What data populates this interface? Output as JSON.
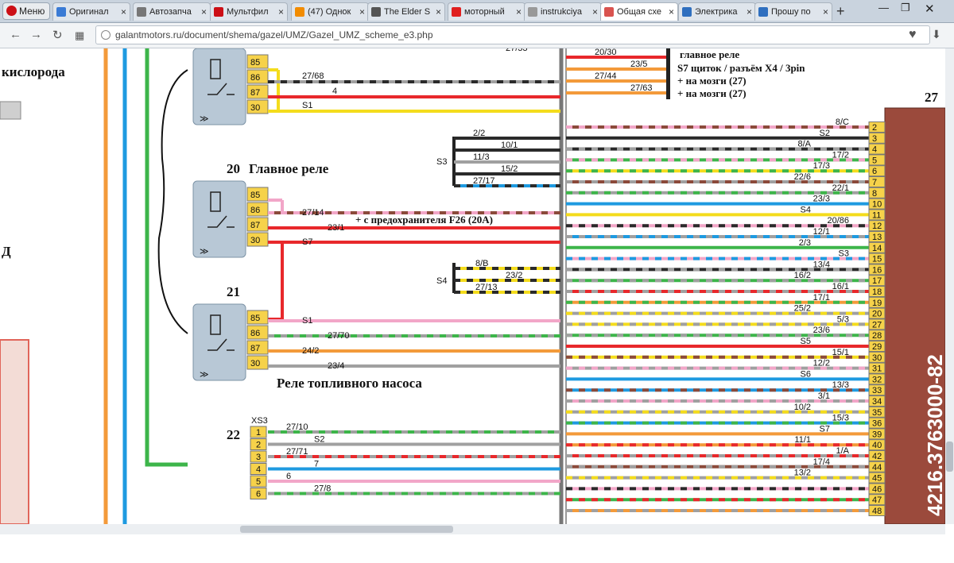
{
  "browser": {
    "menu_label": "Меню",
    "tabs": [
      {
        "title": "Оригинал",
        "icon_color": "#3a7bd5"
      },
      {
        "title": "Автозапча",
        "icon_color": "#777777"
      },
      {
        "title": "Мультфил",
        "icon_color": "#cc0f16"
      },
      {
        "title": "(47) Однок",
        "icon_color": "#f28c00"
      },
      {
        "title": "The Elder S",
        "icon_color": "#555555"
      },
      {
        "title": "моторный",
        "icon_color": "#e02020"
      },
      {
        "title": "instrukciya",
        "icon_color": "#999999"
      },
      {
        "title": "Общая схе",
        "icon_color": "#d9534f"
      },
      {
        "title": "Электрика",
        "icon_color": "#2f6fbf"
      },
      {
        "title": "Прошу по",
        "icon_color": "#2f6fbf"
      }
    ],
    "active_tab": 7,
    "close_glyph": "×",
    "newtab_glyph": "+",
    "url": "galantmotors.ru/document/shema/gazel/UMZ/Gazel_UMZ_scheme_e3.php"
  },
  "diagram": {
    "left_texts": {
      "o2": "кислорода",
      "dd": "Д"
    },
    "relay20": {
      "number": "20",
      "title": "Главное реле",
      "pins": [
        "85",
        "86",
        "87",
        "30"
      ],
      "wires": [
        "27/14",
        "23/1",
        "S7"
      ]
    },
    "relay_top": {
      "pins": [
        "85",
        "86",
        "87",
        "30"
      ],
      "wires": [
        "27/68",
        "4",
        "S1"
      ]
    },
    "relay21": {
      "number": "21",
      "title": "Реле топливного насоса",
      "pins": [
        "85",
        "86",
        "87",
        "30"
      ],
      "wires": [
        "S1",
        "27/70",
        "24/2",
        "23/4"
      ]
    },
    "connector22": {
      "number": "22",
      "name": "XS3",
      "pins": [
        "1",
        "2",
        "3",
        "4",
        "5",
        "6"
      ],
      "wires": [
        "27/10",
        "S2",
        "27/71",
        "7",
        "6",
        "27/8"
      ]
    },
    "s3": {
      "label": "S3",
      "wires": [
        "2/2",
        "10/1",
        "11/3",
        "15/2",
        "27/17"
      ]
    },
    "s4": {
      "label": "S4",
      "wires": [
        "8/B",
        "23/2",
        "27/13"
      ]
    },
    "top_wires": [
      "20/30",
      "23/5",
      "27/44",
      "27/63",
      "27/33"
    ],
    "notes": {
      "main_relay": "главное реле",
      "s7_panel": "S7  щиток / разъём X4 / 3pin",
      "ecu1": "+ на мозги (27)",
      "ecu2": "+ на мозги (27)",
      "fuse": "+ с предохранителя F26 (20A)"
    },
    "ecu": {
      "number": "27",
      "part": "4216.3763000-82",
      "pins": [
        "2",
        "3",
        "4",
        "5",
        "6",
        "7",
        "8",
        "10",
        "11",
        "12",
        "13",
        "14",
        "15",
        "16",
        "17",
        "18",
        "19",
        "20",
        "27",
        "28",
        "29",
        "30",
        "31",
        "32",
        "33",
        "34",
        "35",
        "36",
        "39",
        "40",
        "42",
        "44",
        "45",
        "46",
        "47",
        "48"
      ],
      "wires": [
        "8/C",
        "S2",
        "8/A",
        "17/2",
        "17/3",
        "22/6",
        "22/1",
        "23/3",
        "S4",
        "20/86",
        "12/1",
        "2/3",
        "S3",
        "13/4",
        "16/2",
        "16/1",
        "17/1",
        "25/2",
        "5/3",
        "23/6",
        "S5",
        "15/1",
        "12/2",
        "S6",
        "13/3",
        "3/1",
        "10/2",
        "15/3",
        "S7",
        "11/1",
        "1/A",
        "17/4",
        "13/2"
      ]
    },
    "colors": {
      "red": "#e8282b",
      "yellow": "#f4dc1c",
      "blue": "#1e9ae0",
      "green": "#3db54a",
      "orange": "#f39a3a",
      "pink": "#f2a6c8",
      "brown": "#8b4a3a",
      "gray": "#a0a0a0",
      "black": "#2a2a2a",
      "relay_box": "#b8c8d6",
      "ecu_box": "#9b4a3c"
    }
  }
}
